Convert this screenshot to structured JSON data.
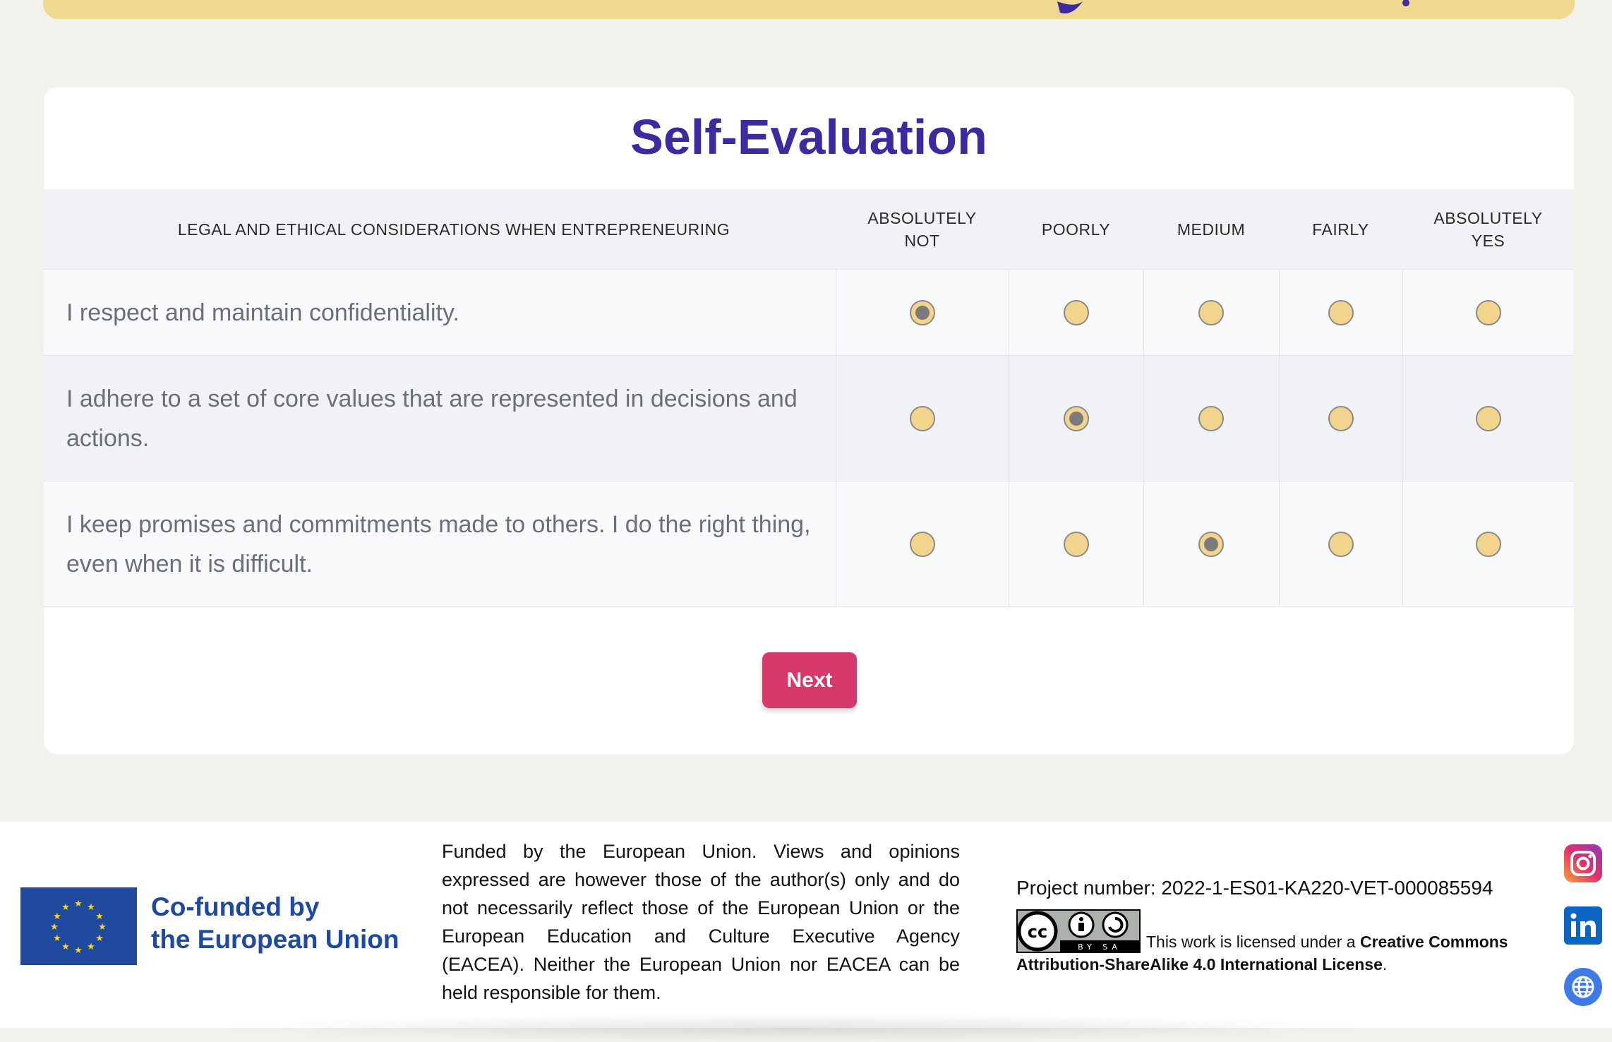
{
  "card": {
    "title": "Self-Evaluation"
  },
  "table": {
    "columns": [
      "LEGAL AND ETHICAL CONSIDERATIONS WHEN ENTREPRENEURING",
      "ABSOLUTELY NOT",
      "POORLY",
      "MEDIUM",
      "FAIRLY",
      "ABSOLUTELY YES"
    ],
    "rows": [
      {
        "statement": "I respect and maintain confidentiality.",
        "selected": "ABSOLUTELY NOT"
      },
      {
        "statement": "I adhere to a set of core values that are represented in decisions and actions.",
        "selected": "POORLY"
      },
      {
        "statement": "I keep promises and commitments made to others. I do the right thing, even when it is difficult.",
        "selected": "MEDIUM"
      }
    ]
  },
  "next_label": "Next",
  "footer": {
    "eu_line1": "Co-funded by",
    "eu_line2": "the European Union",
    "disclaimer": "Funded by the European Union. Views and opinions expressed are however those of the author(s) only and do not necessarily reflect those of the European Union or the European Education and Culture Executive Agency (EACEA). Neither the European Union nor EACEA can be held responsible for them.",
    "project": "Project number: 2022-1-ES01-KA220-VET-000085594",
    "license_prefix": "This work is licensed under a ",
    "license_link": "Creative Commons Attribution-ShareAlike 4.0 International License",
    "license_suffix": ".",
    "cc_badge_text": "BY SA"
  },
  "icons": [
    "instagram-icon",
    "linkedin-icon",
    "globe-icon",
    "cc-by-sa-badge",
    "eu-flag-logo"
  ],
  "colors": {
    "title": "#3b2aa0",
    "next_button": "#d63a6a",
    "radio_fill": "#f2d48c",
    "banner": "#eed98e",
    "eu_blue": "#1f4aa0"
  }
}
